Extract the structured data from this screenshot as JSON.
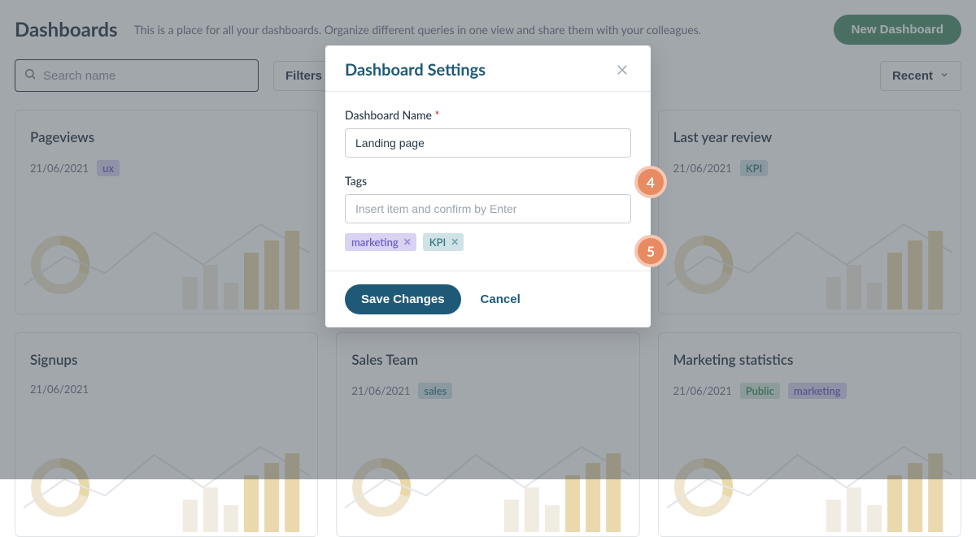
{
  "header": {
    "title": "Dashboards",
    "subtitle": "This is a place for all your dashboards. Organize different queries in one view and share them with your colleagues.",
    "new_button": "New Dashboard"
  },
  "toolbar": {
    "search_placeholder": "Search name",
    "filters_label": "Filters",
    "sort_label": "Recent"
  },
  "cards": [
    {
      "title": "Pageviews",
      "date": "21/06/2021",
      "tags": [
        {
          "text": "ux",
          "cls": "tag-purple"
        }
      ]
    },
    {
      "title": "",
      "date": "",
      "tags": []
    },
    {
      "title": "Last year review",
      "date": "21/06/2021",
      "tags": [
        {
          "text": "KPI",
          "cls": "tag-teal"
        }
      ]
    },
    {
      "title": "Signups",
      "date": "21/06/2021",
      "tags": []
    },
    {
      "title": "Sales Team",
      "date": "21/06/2021",
      "tags": [
        {
          "text": "sales",
          "cls": "tag-teal"
        }
      ]
    },
    {
      "title": "Marketing statistics",
      "date": "21/06/2021",
      "tags": [
        {
          "text": "Public",
          "cls": "tag-green"
        },
        {
          "text": "marketing",
          "cls": "tag-purple"
        }
      ]
    }
  ],
  "modal": {
    "title": "Dashboard Settings",
    "name_label": "Dashboard Name",
    "name_value": "Landing page",
    "tags_label": "Tags",
    "tags_placeholder": "Insert item and confirm by Enter",
    "tags": [
      "marketing",
      "KPI"
    ],
    "save_label": "Save Changes",
    "cancel_label": "Cancel"
  },
  "annotations": {
    "a4": "4",
    "a5": "5"
  }
}
